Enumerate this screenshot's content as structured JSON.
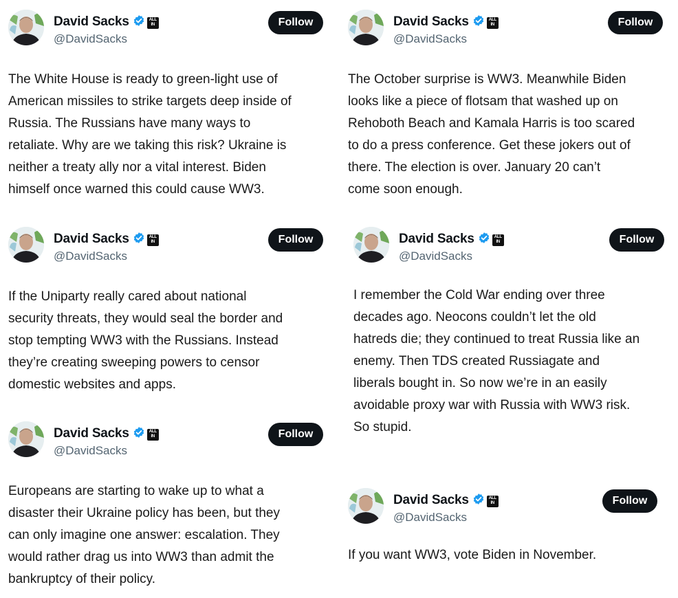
{
  "author": {
    "name": "David Sacks",
    "handle": "@DavidSacks",
    "badge_text": "ALL IN",
    "verified_icon": "verified-badge-icon",
    "accent_color": "#1d9bf0"
  },
  "follow_label": "Follow",
  "tweets": [
    {
      "text": "The White House is ready to green-light use of\nAmerican missiles to strike targets deep inside of\nRussia. The Russians have many ways to\nretaliate. Why are we taking this risk? Ukraine is\nneither a treaty ally nor a vital interest. Biden\nhimself once warned this could cause WW3."
    },
    {
      "text": "The October surprise is WW3. Meanwhile Biden\nlooks like a piece of flotsam that washed up on\nRehoboth Beach and Kamala Harris is too scared\nto do a press conference. Get these jokers out of\nthere. The election is over. January 20 can’t\ncome soon enough."
    },
    {
      "text": "If the Uniparty really cared about national\nsecurity threats, they would seal the border and\nstop tempting WW3 with the Russians. Instead\nthey’re creating sweeping powers to censor\ndomestic websites and apps."
    },
    {
      "text": "I remember the Cold War ending over three\ndecades ago. Neocons couldn’t let the old\nhatreds die; they continued to treat Russia like an\nenemy. Then TDS created Russiagate and\nliberals bought in. So now we’re in an easily\navoidable proxy war with Russia with WW3 risk.\nSo stupid."
    },
    {
      "text": "Europeans are starting to wake up to what a\ndisaster their Ukraine policy has been, but they\ncan only imagine one answer: escalation. They\nwould rather drag us into WW3 than admit the\nbankruptcy of their policy."
    },
    {
      "text": "If you want WW3, vote Biden in November."
    }
  ]
}
